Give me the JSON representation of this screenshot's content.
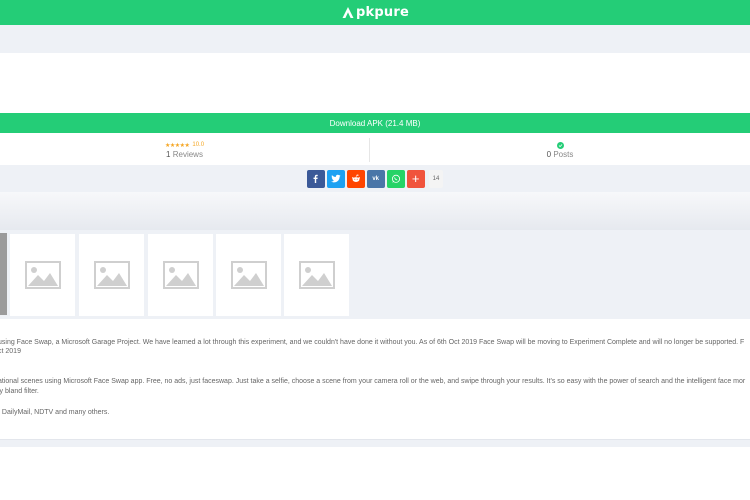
{
  "header": {
    "logo_text": "pkpure",
    "accent": "#24cd77"
  },
  "download": {
    "label": "Download APK (21.4 MB)"
  },
  "rating": {
    "stars": "★★★★★",
    "score": "10.0",
    "reviews_count": "1",
    "reviews_label": " Reviews"
  },
  "posts": {
    "count": "0",
    "label": " Posts"
  },
  "share": {
    "buttons": [
      {
        "name": "facebook",
        "glyph": "f",
        "color": "#3b5998"
      },
      {
        "name": "twitter",
        "glyph": "t",
        "color": "#1da1f2"
      },
      {
        "name": "reddit",
        "glyph": "r",
        "color": "#ff4500"
      },
      {
        "name": "vk",
        "glyph": "vk",
        "color": "#4a76a8"
      },
      {
        "name": "whatsapp",
        "glyph": "w",
        "color": "#25d366"
      },
      {
        "name": "more",
        "glyph": "+",
        "color": "#f0533c"
      }
    ],
    "count": "14"
  },
  "description": {
    "p1_line1": "using Face Swap, a Microsoft Garage Project. We have learned a lot through this experiment, and we couldn't have done it without you. As of 6th Oct 2019 Face Swap will be moving to Experiment Complete and will no longer be supported. F",
    "p1_line2": "ct 2019",
    "p2_line1": "ational scenes using Microsoft Face Swap app. Free, no ads, just faceswap. Just take a selfie, choose a scene from your camera roll or the web, and swipe through your results. It's so easy with the power of search and the intelligent face mor",
    "p2_line2": "ly bland filter.",
    "p3_line1": ", DailyMail, NDTV and many others."
  }
}
